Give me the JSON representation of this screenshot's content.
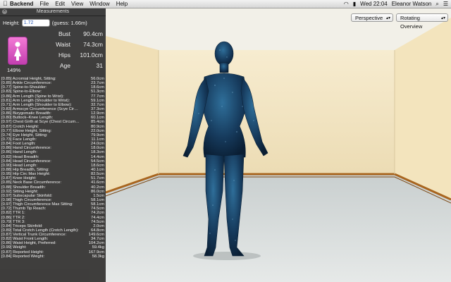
{
  "menubar": {
    "app_name": "Backend",
    "menus": [
      "File",
      "Edit",
      "View",
      "Window",
      "Help"
    ],
    "clock": "Wed 22:04",
    "user": "Eleanor Watson"
  },
  "viewport": {
    "projection": "Perspective",
    "mode": "Rotating Overview"
  },
  "panel": {
    "title": "Measurements",
    "height_label": "Height:",
    "height_value": "1.72",
    "guess": "(guess: 1.66m)",
    "percent": "149%",
    "vitals": [
      {
        "label": "Bust",
        "value": "90.4cm"
      },
      {
        "label": "Waist",
        "value": "74.3cm"
      },
      {
        "label": "Hips",
        "value": "101.0cm"
      },
      {
        "label": "Age",
        "value": "31"
      }
    ],
    "measurements": [
      {
        "label": "[0.85] Acromial Height, Sitting:",
        "value": "56.0cm"
      },
      {
        "label": "[0.85] Ankle Circumference:",
        "value": "23.7cm"
      },
      {
        "label": "[0.77] Spine-to-Shoulder:",
        "value": "18.6cm"
      },
      {
        "label": "[0.83] Spine-to-Elbow:",
        "value": "51.3cm"
      },
      {
        "label": "[0.86] Arm Length (Spine to Wrist):",
        "value": "77.7cm"
      },
      {
        "label": "[0.81] Arm Length (Shoulder to Wrist):",
        "value": "59.1cm"
      },
      {
        "label": "[0.71] Arm Length (Shoulder to Elbow):",
        "value": "32.7cm"
      },
      {
        "label": "[0.83] Armscye Circumference (Scye Cir…",
        "value": "37.3cm"
      },
      {
        "label": "[0.86] Bizygomatic Breadth:",
        "value": "12.9cm"
      },
      {
        "label": "[0.80] Buttock–Knee Length:",
        "value": "60.1cm"
      },
      {
        "label": "[0.97] Chest Girth at Scye (Chest Circum…",
        "value": "85.4cm"
      },
      {
        "label": "[0.87] Crotch Height:",
        "value": "80.9cm"
      },
      {
        "label": "[0.77] Elbow Height, Sitting:",
        "value": "22.0cm"
      },
      {
        "label": "[0.74] Eye Height, Sitting:",
        "value": "79.9cm"
      },
      {
        "label": "[0.73] Face Length:",
        "value": "11.1cm"
      },
      {
        "label": "[0.84] Foot Length:",
        "value": "24.0cm"
      },
      {
        "label": "[0.86] Hand Circumference:",
        "value": "18.0cm"
      },
      {
        "label": "[0.86] Hand Length:",
        "value": "18.3cm"
      },
      {
        "label": "[0.82] Head Breadth:",
        "value": "14.4cm"
      },
      {
        "label": "[0.84] Head Circumference:",
        "value": "54.5cm"
      },
      {
        "label": "[0.90] Head Length:",
        "value": "18.6cm"
      },
      {
        "label": "[0.88] Hip Breadth, Sitting:",
        "value": "40.1cm"
      },
      {
        "label": "[0.95] Hip Circ Max Height:",
        "value": "82.5cm"
      },
      {
        "label": "[0.87] Knee Height:",
        "value": "51.7cm"
      },
      {
        "label": "[0.85] Neck Base Circumference:",
        "value": "41.6cm"
      },
      {
        "label": "[0.88] Shoulder Breadth:",
        "value": "40.2cm"
      },
      {
        "label": "[0.92] Sitting Height:",
        "value": "86.0cm"
      },
      {
        "label": "[0.97] Subscapular Skinfold:",
        "value": "1.5cm"
      },
      {
        "label": "[0.98] Thigh Circumference:",
        "value": "58.1cm"
      },
      {
        "label": "[0.97] Thigh Circumference Max Sitting:",
        "value": "58.1cm"
      },
      {
        "label": "[0.72] Thumb Tip Reach:",
        "value": "74.5cm"
      },
      {
        "label": "[0.82] TTR 1:",
        "value": "74.2cm"
      },
      {
        "label": "[0.86] TTR 2:",
        "value": "74.4cm"
      },
      {
        "label": "[0.79] TTR 3:",
        "value": "74.5cm"
      },
      {
        "label": "[0.84] Triceps Skinfold:",
        "value": "2.0cm"
      },
      {
        "label": "[0.89] Total Crotch Length (Crotch Length):",
        "value": "64.8cm"
      },
      {
        "label": "[0.87] Vertical Trunk Circumference:",
        "value": "149.6cm"
      },
      {
        "label": "[0.82] Waist Front Length:",
        "value": "34.7cm"
      },
      {
        "label": "[0.86] Waist Height, Preferred:",
        "value": "104.2cm"
      },
      {
        "label": "[0.99] Weight:",
        "value": "59.4kg"
      },
      {
        "label": "[0.87] Reported Height:",
        "value": "167.9cm"
      },
      {
        "label": "[0.84] Reported Weight:",
        "value": "58.3kg"
      }
    ]
  },
  "colors": {
    "wall": "#f2e3bf",
    "floor": "#d4d8d6",
    "trim": "#b06a28",
    "figure": "#17436a",
    "gender_button": "#e05fcc"
  },
  "icons": [
    "apple-icon",
    "close-icon",
    "female-icon",
    "wifi-icon",
    "battery-icon",
    "search-icon",
    "list-icon"
  ]
}
